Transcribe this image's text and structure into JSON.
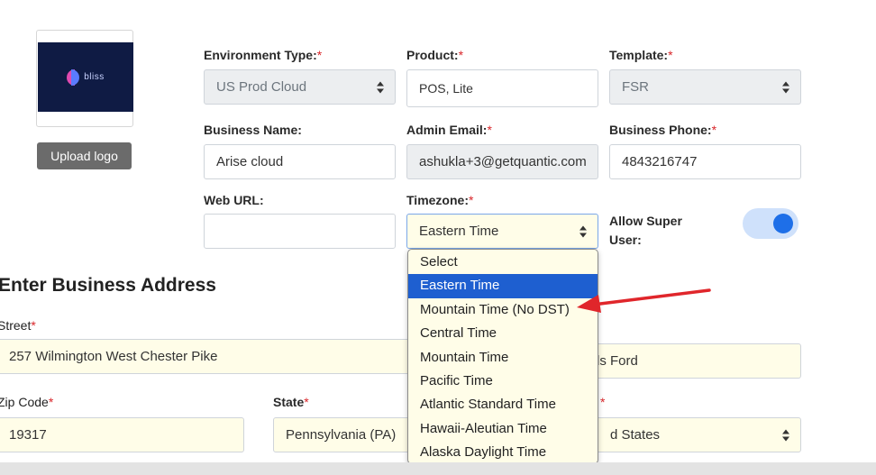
{
  "logo": {
    "brand_text": "bliss",
    "upload_label": "Upload logo"
  },
  "fields": {
    "environment_type": {
      "label": "Environment Type:",
      "value": "US Prod Cloud",
      "required": true
    },
    "product": {
      "label": "Product:",
      "value": "POS, Lite",
      "required": true
    },
    "template": {
      "label": "Template:",
      "value": "FSR",
      "required": true
    },
    "business_name": {
      "label": "Business Name:",
      "value": "Arise cloud"
    },
    "admin_email": {
      "label": "Admin Email:",
      "value": "ashukla+3@getquantic.com",
      "required": true
    },
    "business_phone": {
      "label": "Business Phone:",
      "value": "4843216747",
      "required": true
    },
    "web_url": {
      "label": "Web URL:",
      "value": ""
    },
    "timezone": {
      "label": "Timezone:",
      "value": "Eastern Time",
      "required": true
    },
    "allow_super_user": {
      "label_line1": "Allow Super",
      "label_line2": "User:",
      "enabled": true
    }
  },
  "address": {
    "section_title": "Enter Business Address",
    "street": {
      "label": "Street",
      "value": "257 Wilmington West Chester Pike",
      "required": true
    },
    "city": {
      "value_partial": "ds Ford"
    },
    "zip": {
      "label": "Zip Code",
      "value": "19317",
      "required": true
    },
    "state": {
      "label": "State",
      "value": "Pennsylvania (PA)",
      "required": true
    },
    "country": {
      "value_partial": "d States"
    }
  },
  "required_marker": "*",
  "timezone_dropdown": {
    "options": [
      "Select",
      "Eastern Time",
      "Mountain Time (No DST)",
      "Central Time",
      "Mountain Time",
      "Pacific Time",
      "Atlantic Standard Time",
      "Hawaii-Aleutian Time",
      "Alaska Daylight Time"
    ],
    "selected": "Eastern Time"
  },
  "colors": {
    "accent": "#1e6fe8",
    "selected_option": "#1e5fd0",
    "required": "#d9262a",
    "annotation_arrow": "#e0262b",
    "autofill_bg": "#fffde8"
  }
}
